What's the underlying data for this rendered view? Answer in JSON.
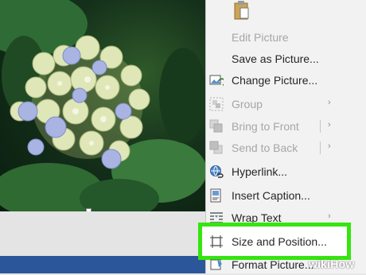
{
  "menu": {
    "items": [
      {
        "label": "Edit Picture",
        "icon": "edit-picture-icon",
        "enabled": false
      },
      {
        "label": "Save as Picture...",
        "icon": "",
        "enabled": true
      },
      {
        "label": "Change Picture...",
        "icon": "change-picture-icon",
        "enabled": true
      },
      {
        "label": "Group",
        "icon": "group-icon",
        "enabled": false,
        "submenu": true
      },
      {
        "label": "Bring to Front",
        "icon": "bring-to-front-icon",
        "enabled": false,
        "submenu": true
      },
      {
        "label": "Send to Back",
        "icon": "send-to-back-icon",
        "enabled": false,
        "submenu": true
      },
      {
        "label": "Hyperlink...",
        "icon": "hyperlink-icon",
        "enabled": true
      },
      {
        "label": "Insert Caption...",
        "icon": "insert-caption-icon",
        "enabled": true
      },
      {
        "label": "Wrap Text",
        "icon": "wrap-text-icon",
        "enabled": true,
        "submenu": true
      },
      {
        "label": "Size and Position...",
        "icon": "size-position-icon",
        "enabled": true,
        "highlighted": true
      },
      {
        "label": "Format Picture...",
        "icon": "format-picture-icon",
        "enabled": true
      }
    ],
    "arrow_glyph": "›"
  },
  "watermark": "wikiHow",
  "colors": {
    "highlight_border": "#35e50f",
    "taskbar": "#2b579a",
    "menu_bg": "#f2f2f2",
    "disabled_text": "#a6a6a6"
  }
}
